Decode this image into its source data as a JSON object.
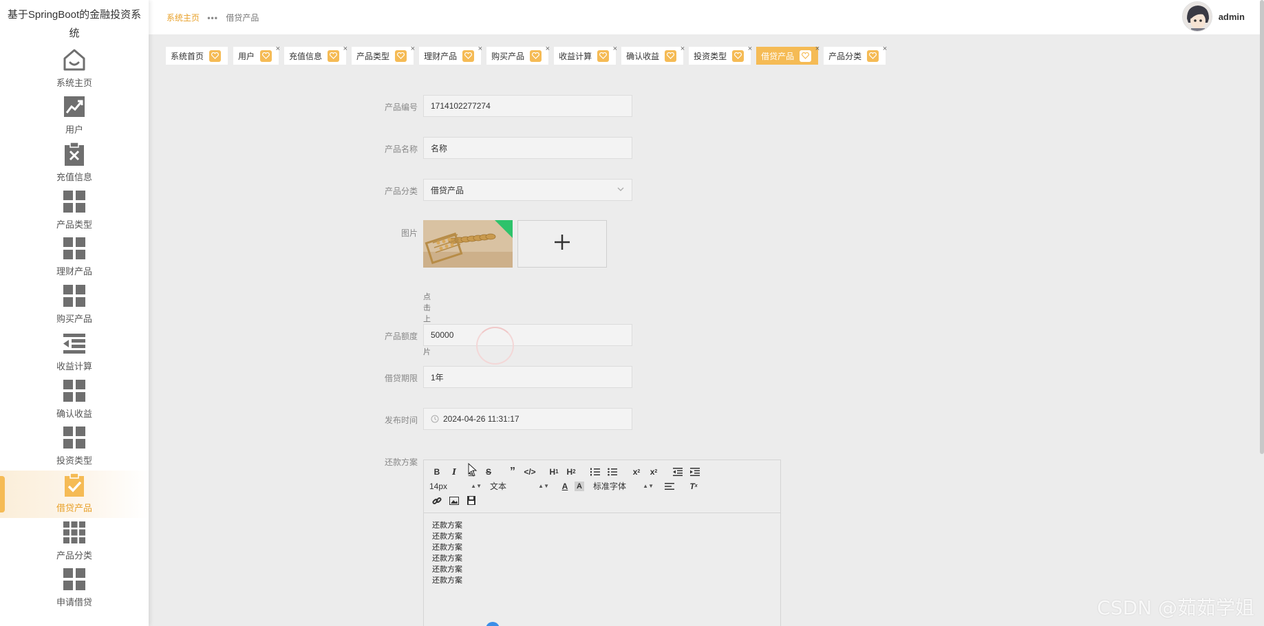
{
  "app": {
    "title": "基于SpringBoot的金融投资系统"
  },
  "colors": {
    "accent": "#f5bb55",
    "accent_text": "#e8a028",
    "icon": "#6f6f6f",
    "bg": "#ececec"
  },
  "sidebar": {
    "items": [
      {
        "label": "系统主页",
        "icon": "home-icon"
      },
      {
        "label": "用户",
        "icon": "trend-chart-icon"
      },
      {
        "label": "充值信息",
        "icon": "clipboard-x-icon"
      },
      {
        "label": "产品类型",
        "icon": "grid-icon"
      },
      {
        "label": "理财产品",
        "icon": "grid-icon"
      },
      {
        "label": "购买产品",
        "icon": "grid-icon"
      },
      {
        "label": "收益计算",
        "icon": "indent-list-icon"
      },
      {
        "label": "确认收益",
        "icon": "grid-icon"
      },
      {
        "label": "投资类型",
        "icon": "grid-icon"
      },
      {
        "label": "借贷产品",
        "icon": "clipboard-check-icon",
        "active": true
      },
      {
        "label": "产品分类",
        "icon": "grid-9-icon"
      },
      {
        "label": "申请借贷",
        "icon": "grid-icon"
      }
    ]
  },
  "header": {
    "breadcrumb": {
      "home": "系统主页",
      "current": "借贷产品"
    },
    "user": {
      "name": "admin"
    }
  },
  "tabs": [
    {
      "label": "系统首页"
    },
    {
      "label": "用户"
    },
    {
      "label": "充值信息"
    },
    {
      "label": "产品类型"
    },
    {
      "label": "理财产品"
    },
    {
      "label": "购买产品"
    },
    {
      "label": "收益计算"
    },
    {
      "label": "确认收益"
    },
    {
      "label": "投资类型"
    },
    {
      "label": "借贷产品",
      "active": true
    },
    {
      "label": "产品分类"
    }
  ],
  "form": {
    "product_no": {
      "label": "产品编号",
      "value": "1714102277274"
    },
    "product_name": {
      "label": "产品名称",
      "value": "名称"
    },
    "category": {
      "label": "产品分类",
      "value": "借贷产品"
    },
    "image": {
      "label": "图片",
      "hint": "点击上传图片"
    },
    "amount": {
      "label": "产品额度",
      "value": "50000"
    },
    "term": {
      "label": "借贷期限",
      "value": "1年"
    },
    "publish_time": {
      "label": "发布时间",
      "value": "2024-04-26 11:31:17"
    },
    "repayment": {
      "label": "还款方案",
      "toolbar": {
        "font_size": "14px",
        "block_type": "文本",
        "font_family": "标准字体"
      },
      "lines": [
        "还款方案",
        "还款方案",
        "还款方案",
        "还款方案",
        "还款方案",
        "还款方案"
      ]
    }
  },
  "watermark": "CSDN @茹茹学姐"
}
